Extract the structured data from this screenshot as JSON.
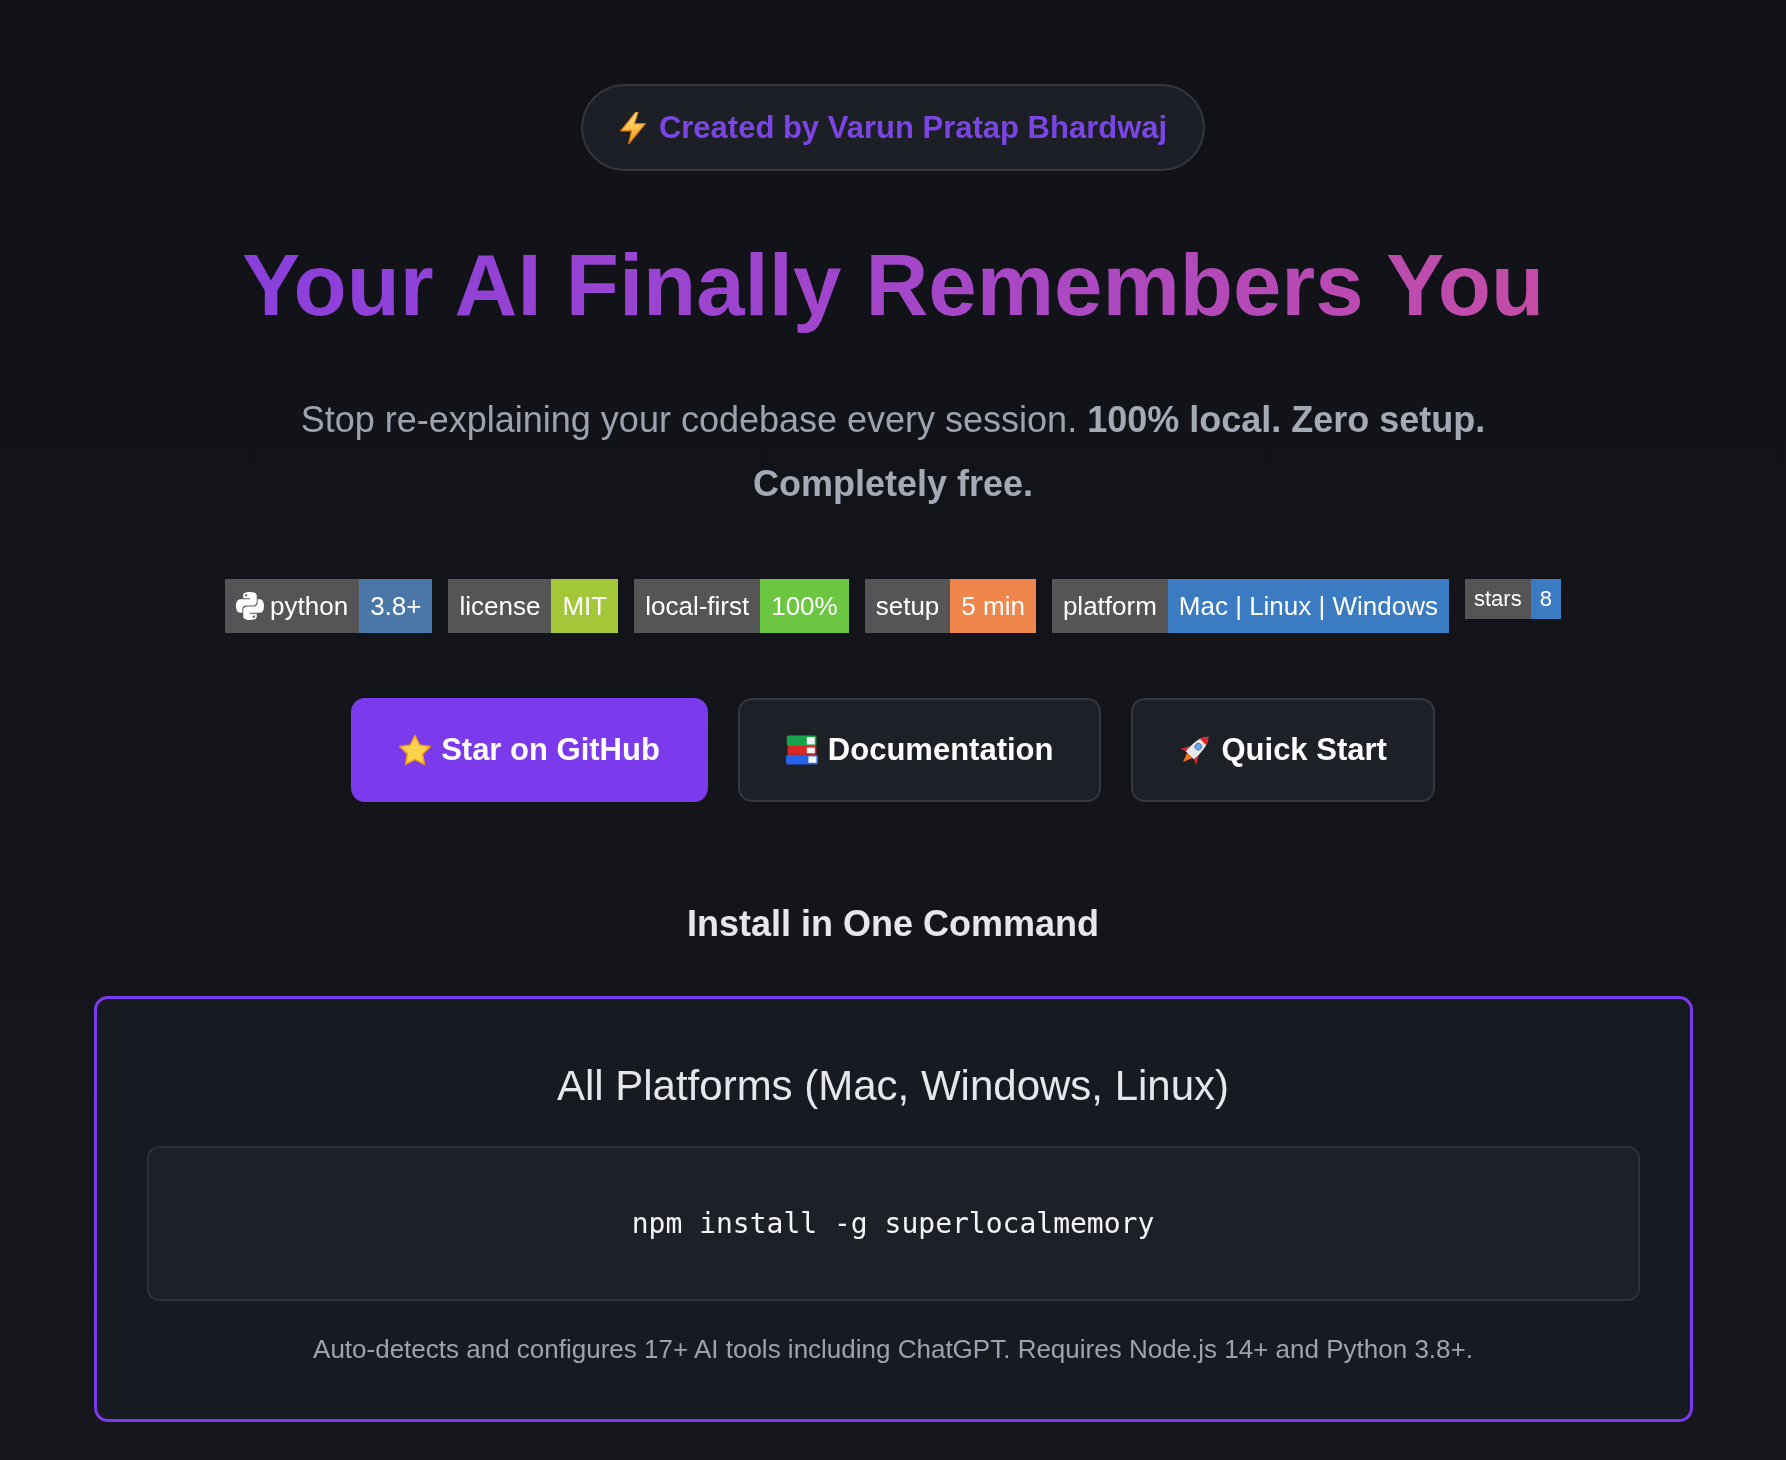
{
  "author_badge": {
    "text": "Created by Varun Pratap Bhardwaj"
  },
  "hero": {
    "title": "Your AI Finally Remembers You",
    "subtitle": "Stop re-explaining your codebase every session. **100% local. Zero setup. Completely free.**"
  },
  "badges": [
    {
      "kind": "logo",
      "label": "python",
      "value": "3.8+",
      "color": "#4a76a8"
    },
    {
      "kind": "plain",
      "label": "license",
      "value": "MIT",
      "color": "#a4c639"
    },
    {
      "kind": "plain",
      "label": "local-first",
      "value": "100%",
      "color": "#6cc641"
    },
    {
      "kind": "plain",
      "label": "setup",
      "value": "5 min",
      "color": "#ef874c"
    },
    {
      "kind": "plain",
      "label": "platform",
      "value": "Mac | Linux | Windows",
      "color": "#3a7bc2"
    },
    {
      "kind": "small",
      "label": "stars",
      "value": "8",
      "color": "#3a7bc2"
    }
  ],
  "buttons": [
    {
      "label": "Star on GitHub",
      "kind": "primary"
    },
    {
      "label": "Documentation",
      "kind": "secondary"
    },
    {
      "label": "Quick Start",
      "kind": "secondary"
    }
  ],
  "install": {
    "heading": "Install in One Command",
    "card": {
      "title": "All Platforms (Mac, Windows, Linux)",
      "command": "npm install -g superlocalmemory",
      "note": "Auto-detects and configures 17+ AI tools including ChatGPT. Requires Node.js 14+ and Python 3.8+."
    }
  }
}
